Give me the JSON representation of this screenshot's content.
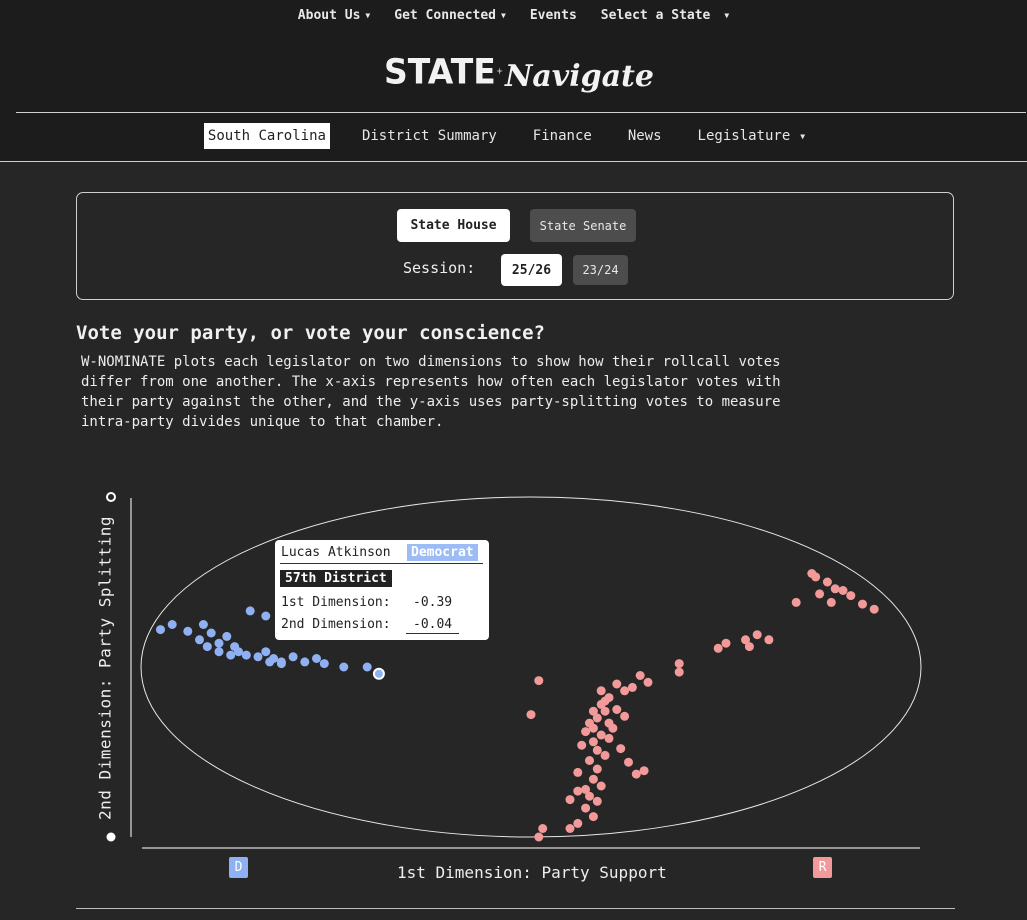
{
  "topnav": {
    "items": [
      {
        "label": "About Us",
        "dropdown": true
      },
      {
        "label": "Get Connected",
        "dropdown": true
      },
      {
        "label": "Events",
        "dropdown": false
      },
      {
        "label": "Select a State",
        "dropdown": true
      }
    ]
  },
  "logo": {
    "left": "STATE",
    "right": "Navigate"
  },
  "subnav": {
    "state": "South Carolina",
    "district_summary": "District Summary",
    "finance": "Finance",
    "news": "News",
    "legislature": "Legislature"
  },
  "controls": {
    "chamber_house": "State House",
    "chamber_senate": "State Senate",
    "session_label": "Session:",
    "session_current": "25/26",
    "session_prev": "23/24"
  },
  "article": {
    "heading": "Vote your party, or vote your conscience?",
    "description": "W-NOMINATE plots each legislator on two dimensions to show how their rollcall votes differ from one another. The x-axis represents how often each legislator votes with their party against the other, and the y-axis uses party-splitting votes to measure intra-party divides unique to that chamber."
  },
  "tooltip": {
    "name": "Lucas Atkinson",
    "party": "Democrat",
    "district": "57th District",
    "dim1_label": "1st Dimension:",
    "dim1_value": "-0.39",
    "dim2_label": "2nd Dimension:",
    "dim2_value": "-0.04"
  },
  "colors": {
    "democrat": "#8fb0f2",
    "republican": "#f29a9a",
    "background": "#262626"
  },
  "chart_data": {
    "type": "scatter",
    "xlabel": "1st Dimension: Party Support",
    "ylabel": "2nd Dimension: Party Splitting",
    "x_badges": [
      "D",
      "R"
    ],
    "xlim": [
      -1,
      1
    ],
    "ylim": [
      -1,
      1
    ],
    "series": [
      {
        "name": "Democrat",
        "points": [
          [
            -0.95,
            0.22
          ],
          [
            -0.92,
            0.25
          ],
          [
            -0.88,
            0.21
          ],
          [
            -0.84,
            0.25
          ],
          [
            -0.82,
            0.2
          ],
          [
            -0.85,
            0.16
          ],
          [
            -0.83,
            0.12
          ],
          [
            -0.8,
            0.14
          ],
          [
            -0.78,
            0.18
          ],
          [
            -0.76,
            0.12
          ],
          [
            -0.8,
            0.09
          ],
          [
            -0.77,
            0.07
          ],
          [
            -0.75,
            0.09
          ],
          [
            -0.73,
            0.07
          ],
          [
            -0.7,
            0.06
          ],
          [
            -0.68,
            0.09
          ],
          [
            -0.66,
            0.05
          ],
          [
            -0.64,
            0.03
          ],
          [
            -0.61,
            0.06
          ],
          [
            -0.58,
            0.03
          ],
          [
            -0.67,
            0.03
          ],
          [
            -0.68,
            0.3
          ],
          [
            -0.72,
            0.33
          ],
          [
            -0.64,
            0.02
          ],
          [
            -0.55,
            0.05
          ],
          [
            -0.53,
            0.02
          ],
          [
            -0.48,
            0.0
          ],
          [
            -0.42,
            0.0
          ],
          [
            -0.39,
            -0.04
          ]
        ]
      },
      {
        "name": "Republican",
        "points": [
          [
            0.72,
            0.55
          ],
          [
            0.73,
            0.53
          ],
          [
            0.76,
            0.5
          ],
          [
            0.78,
            0.46
          ],
          [
            0.8,
            0.45
          ],
          [
            0.82,
            0.42
          ],
          [
            0.77,
            0.38
          ],
          [
            0.74,
            0.43
          ],
          [
            0.85,
            0.37
          ],
          [
            0.88,
            0.34
          ],
          [
            0.68,
            0.38
          ],
          [
            0.55,
            0.16
          ],
          [
            0.58,
            0.19
          ],
          [
            0.61,
            0.16
          ],
          [
            0.56,
            0.12
          ],
          [
            0.5,
            0.14
          ],
          [
            0.48,
            0.11
          ],
          [
            0.38,
            0.02
          ],
          [
            0.38,
            -0.03
          ],
          [
            0.28,
            -0.05
          ],
          [
            0.3,
            -0.09
          ],
          [
            0.26,
            -0.12
          ],
          [
            0.22,
            -0.1
          ],
          [
            0.24,
            -0.14
          ],
          [
            0.2,
            -0.18
          ],
          [
            0.18,
            -0.22
          ],
          [
            0.19,
            -0.26
          ],
          [
            0.17,
            -0.3
          ],
          [
            0.15,
            -0.33
          ],
          [
            0.16,
            -0.36
          ],
          [
            0.14,
            -0.38
          ],
          [
            0.18,
            -0.4
          ],
          [
            0.2,
            -0.42
          ],
          [
            0.16,
            -0.44
          ],
          [
            0.13,
            -0.46
          ],
          [
            0.17,
            -0.49
          ],
          [
            0.19,
            -0.52
          ],
          [
            0.15,
            -0.55
          ],
          [
            0.17,
            -0.6
          ],
          [
            0.12,
            -0.62
          ],
          [
            0.16,
            -0.66
          ],
          [
            0.18,
            -0.7
          ],
          [
            0.14,
            -0.72
          ],
          [
            0.15,
            -0.76
          ],
          [
            0.17,
            -0.79
          ],
          [
            0.14,
            -0.83
          ],
          [
            0.16,
            -0.88
          ],
          [
            0.12,
            -0.92
          ],
          [
            0.1,
            -0.95
          ],
          [
            0.2,
            -0.33
          ],
          [
            0.22,
            -0.25
          ],
          [
            0.24,
            -0.29
          ],
          [
            0.21,
            -0.36
          ],
          [
            0.23,
            -0.48
          ],
          [
            0.25,
            -0.56
          ],
          [
            0.27,
            -0.63
          ],
          [
            0.29,
            -0.61
          ],
          [
            0.12,
            -0.73
          ],
          [
            0.1,
            -0.78
          ],
          [
            0.03,
            -0.95
          ],
          [
            0.02,
            -1.0
          ],
          [
            0.0,
            -0.28
          ],
          [
            0.02,
            -0.08
          ],
          [
            0.19,
            -0.2
          ],
          [
            0.18,
            -0.14
          ],
          [
            0.16,
            -0.26
          ]
        ]
      }
    ],
    "highlighted": {
      "name": "Lucas Atkinson",
      "x": -0.39,
      "y": -0.04
    }
  }
}
